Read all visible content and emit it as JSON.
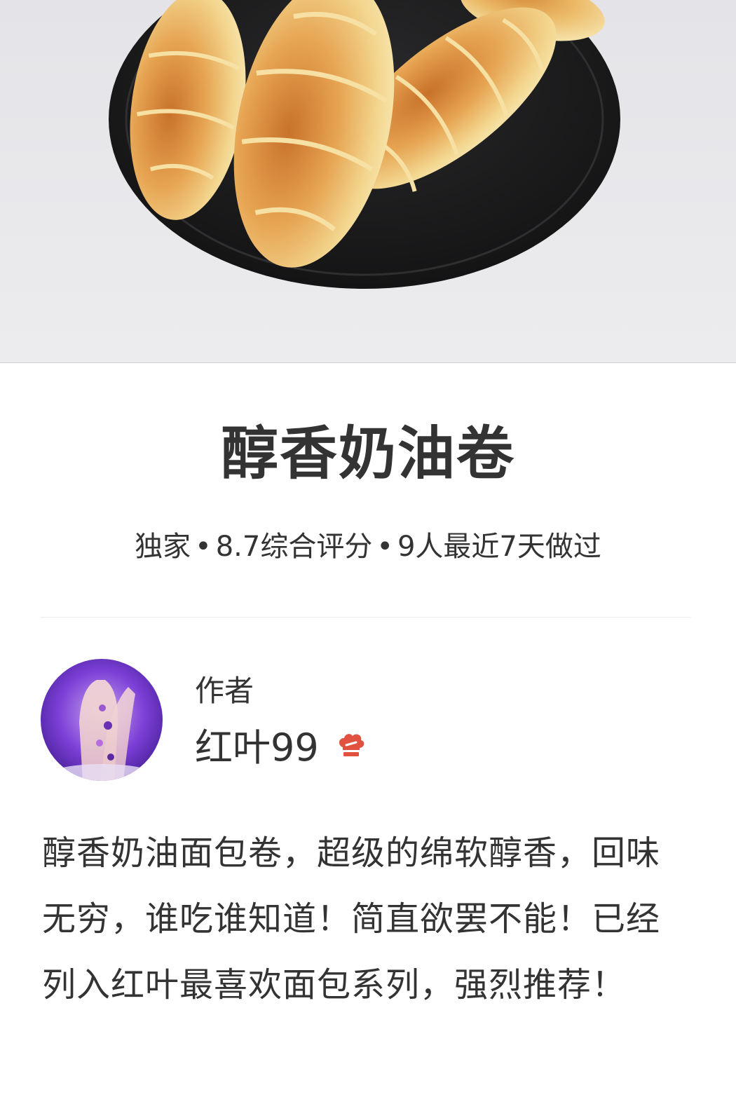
{
  "recipe": {
    "title": "醇香奶油卷",
    "meta": {
      "tag": "独家",
      "rating_text": "8.7综合评分",
      "made_text": "9人最近7天做过",
      "separator": "•"
    }
  },
  "author": {
    "label": "作者",
    "name": "红叶99",
    "badge_icon": "chef-hat-icon"
  },
  "description": "醇香奶油面包卷，超级的绵软醇香，回味无穷，谁吃谁知道！简直欲罢不能！已经列入红叶最喜欢面包系列，强烈推荐！",
  "colors": {
    "text": "#333333",
    "badge": "#e0513f",
    "plate": "#1d1d1f",
    "background": "#ffffff"
  }
}
